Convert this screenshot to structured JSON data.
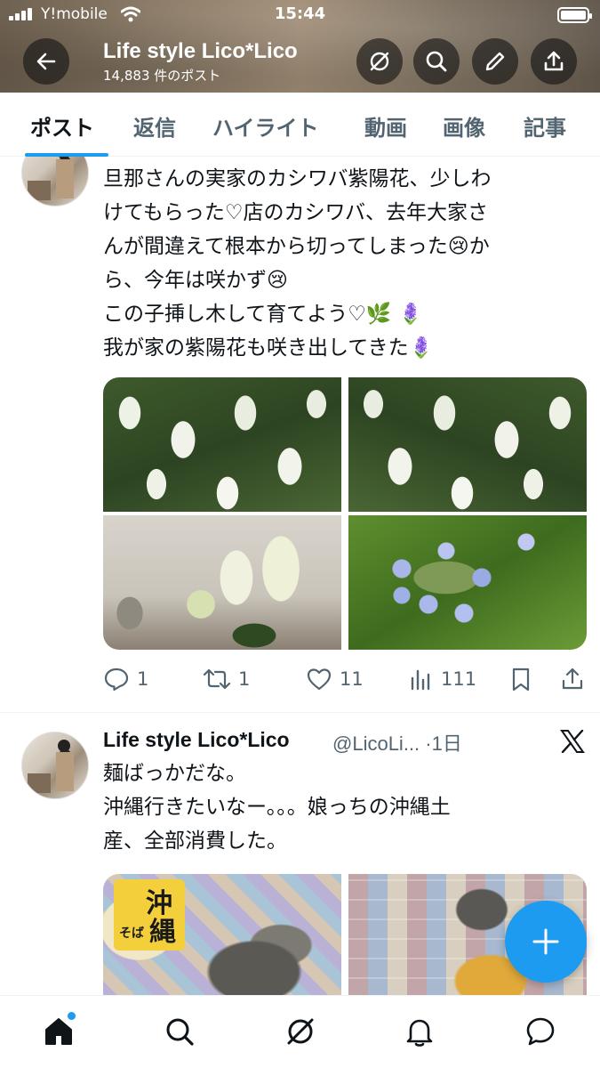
{
  "status_bar": {
    "carrier": "Y!mobile",
    "time": "15:44"
  },
  "header": {
    "title": "Life style Lico*Lico",
    "post_count": "14,883 件のポスト",
    "icons": [
      "back-arrow-icon",
      "grok-icon",
      "search-icon",
      "edit-icon",
      "share-icon"
    ]
  },
  "tabs": [
    {
      "label": "ポスト",
      "active": true
    },
    {
      "label": "返信",
      "active": false
    },
    {
      "label": "ハイライト",
      "active": false
    },
    {
      "label": "動画",
      "active": false
    },
    {
      "label": "画像",
      "active": false
    },
    {
      "label": "記事",
      "active": false
    }
  ],
  "post1": {
    "text_lines": [
      "旦那さんの実家のカシワバ紫陽花、少しわ",
      "けてもらった♡店のカシワバ、去年大家さ",
      "んが間違えて根本から切ってしまった😢か",
      "ら、今年は咲かず😢",
      "この子挿し木して育てよう♡🌿 🪻",
      "我が家の紫陽花も咲き出してきた🪻"
    ],
    "images": [
      "white oakleaf hydrangea",
      "white oakleaf hydrangea",
      "hydrangea cuttings indoors",
      "blue lacecap hydrangea"
    ],
    "replies": "1",
    "reposts": "1",
    "likes": "11",
    "views": "111"
  },
  "post2": {
    "author_name": "Life style Lico*Lico",
    "author_handle": "@LicoLi...",
    "time": "·1日",
    "text_lines": [
      "麺ばっかだな。",
      "沖縄行きたいなー。。。娘っちの沖縄土",
      "産、全部消費した。"
    ],
    "noodle_label_top": "沖",
    "noodle_label_bottom": "縄",
    "noodle_label_small": "そば"
  },
  "colors": {
    "accent": "#1d9bf0",
    "text": "#0f1419",
    "muted": "#536471"
  }
}
